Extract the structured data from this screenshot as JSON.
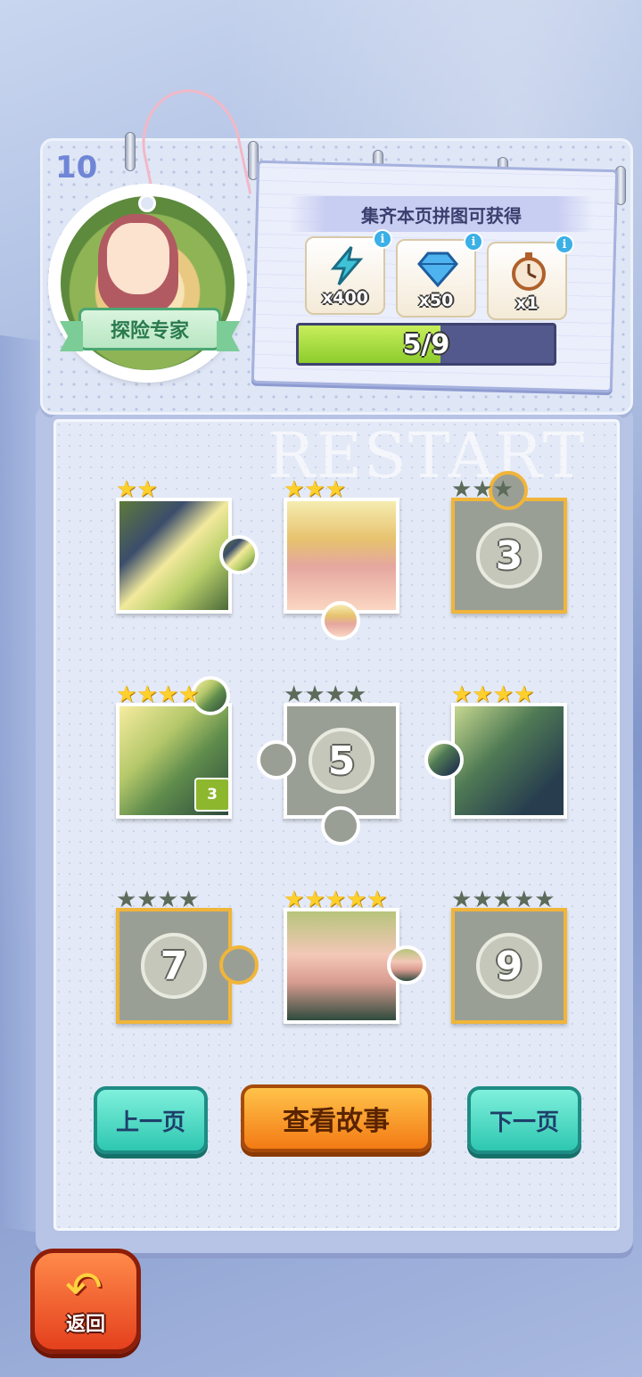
{
  "page_number": "10",
  "badge": {
    "title": "探险专家"
  },
  "rewards": {
    "title": "集齐本页拼图可获得",
    "items": [
      {
        "icon": "energy-bolt-icon",
        "count": "x400",
        "color": "#3fc2d6"
      },
      {
        "icon": "diamond-icon",
        "count": "x50",
        "color": "#4fb3f0"
      },
      {
        "icon": "stopwatch-icon",
        "count": "x1",
        "color": "#d98b4a"
      }
    ],
    "info_label": "i"
  },
  "progress": {
    "text": "5/9",
    "value": 5,
    "max": 9
  },
  "watermark": "RESTART",
  "pieces": [
    {
      "id": 1,
      "unlocked": true,
      "stars_on": 2,
      "stars_total": 2
    },
    {
      "id": 2,
      "unlocked": true,
      "stars_on": 3,
      "stars_total": 3
    },
    {
      "id": 3,
      "unlocked": false,
      "number": "3",
      "stars_on": 0,
      "stars_total": 3
    },
    {
      "id": 4,
      "unlocked": true,
      "stars_on": 4,
      "stars_total": 4,
      "tag": "3"
    },
    {
      "id": 5,
      "unlocked": false,
      "number": "5",
      "stars_on": 0,
      "stars_total": 4
    },
    {
      "id": 6,
      "unlocked": true,
      "stars_on": 4,
      "stars_total": 4
    },
    {
      "id": 7,
      "unlocked": false,
      "number": "7",
      "stars_on": 0,
      "stars_total": 4
    },
    {
      "id": 8,
      "unlocked": true,
      "stars_on": 5,
      "stars_total": 5
    },
    {
      "id": 9,
      "unlocked": false,
      "number": "9",
      "stars_on": 0,
      "stars_total": 5
    }
  ],
  "buttons": {
    "prev": "上一页",
    "story": "查看故事",
    "next": "下一页",
    "back": "返回"
  }
}
